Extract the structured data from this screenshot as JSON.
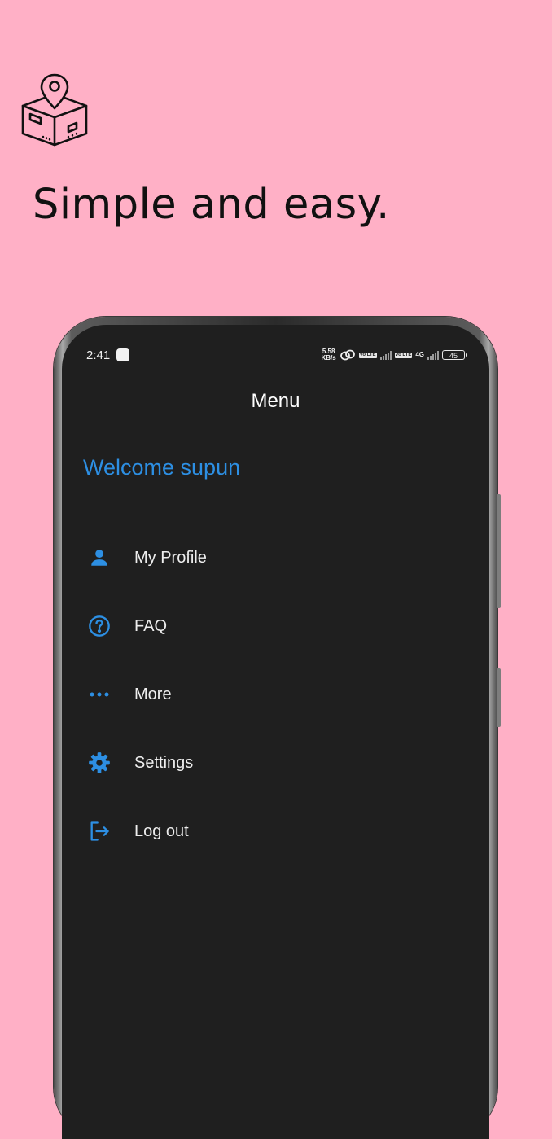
{
  "promo": {
    "headline": "Simple and easy.",
    "icon": "package-location-icon"
  },
  "status_bar": {
    "time": "2:41",
    "net_speed_value": "5.58",
    "net_speed_unit": "KB/s",
    "volte_1": "Vo LTE",
    "volte_2": "Vo LTE",
    "network_type": "4G",
    "battery": "45"
  },
  "app": {
    "title": "Menu",
    "welcome": "Welcome supun"
  },
  "menu": {
    "items": [
      {
        "label": "My Profile",
        "icon": "person-icon"
      },
      {
        "label": "FAQ",
        "icon": "help-circle-icon"
      },
      {
        "label": "More",
        "icon": "more-dots-icon"
      },
      {
        "label": "Settings",
        "icon": "gear-icon"
      },
      {
        "label": "Log out",
        "icon": "logout-icon"
      }
    ]
  },
  "colors": {
    "background": "#ffb0c6",
    "screen": "#1f1f1f",
    "accent": "#2d8fe3",
    "text": "#eeeeee"
  }
}
